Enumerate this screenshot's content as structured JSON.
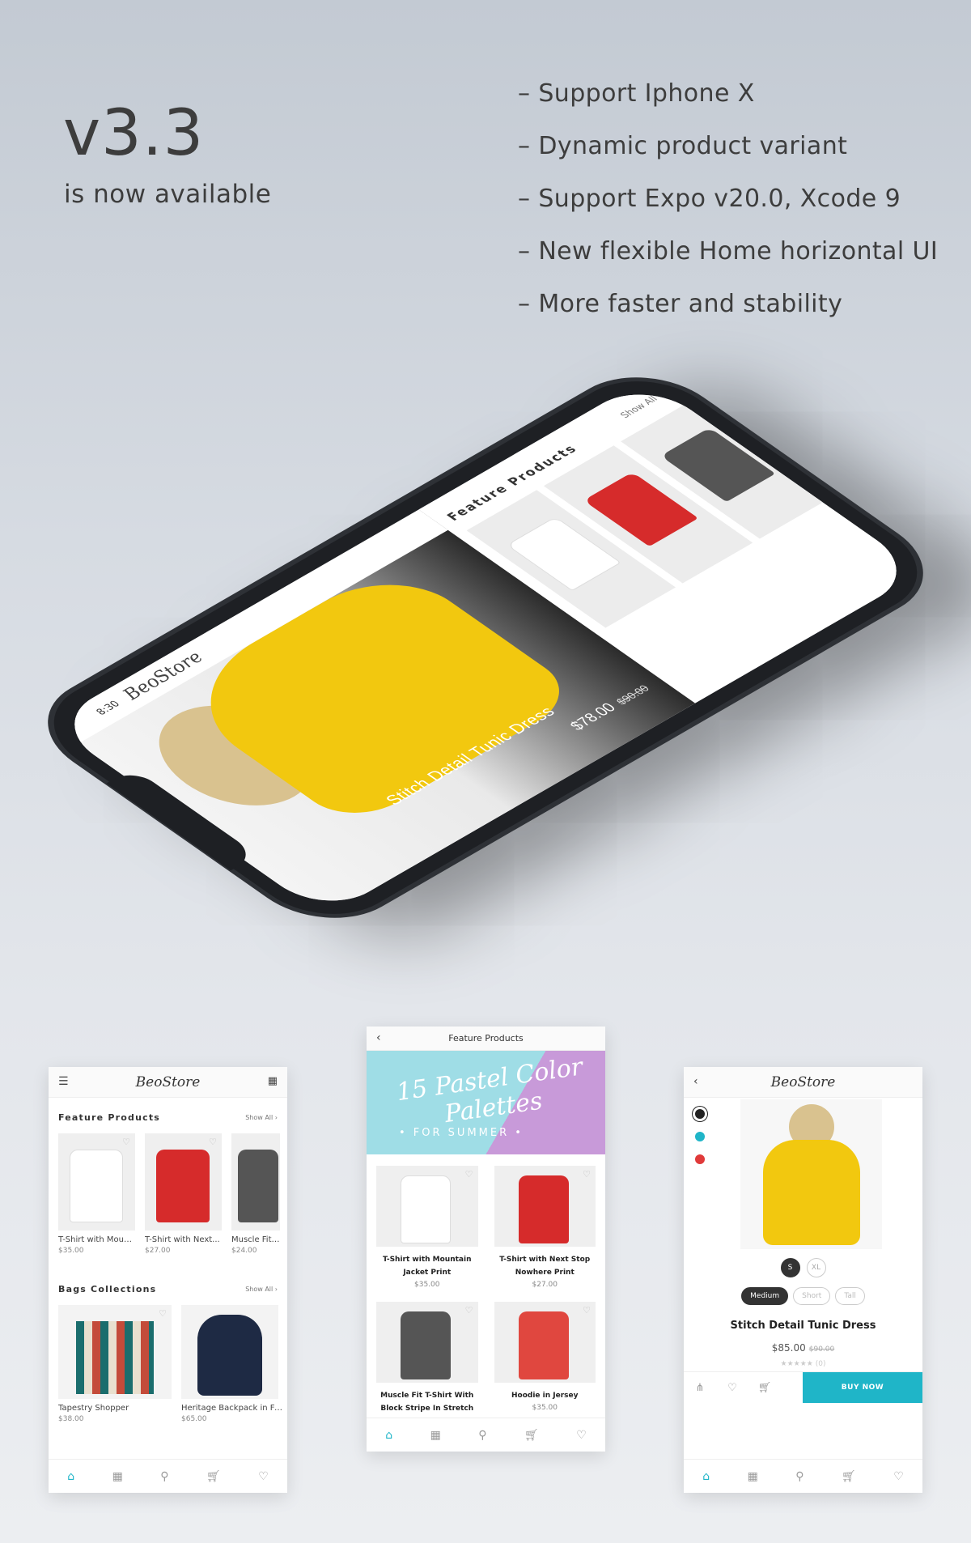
{
  "headline": {
    "version": "v3.3",
    "subtitle": "is now available"
  },
  "features": [
    "– Support Iphone X",
    "– Dynamic product variant",
    "– Support Expo v20.0, Xcode 9",
    "– New flexible Home horizontal UI",
    "– More faster and stability"
  ],
  "phone": {
    "status_time": "8:30",
    "brand": "BeoStore",
    "hero_title": "Stitch Detail Tunic Dress",
    "hero_price": "$78.00",
    "hero_old_price": "$90.00",
    "section_title": "Feature Products",
    "show_all": "Show All"
  },
  "left_screen": {
    "brand": "BeoStore",
    "section1": {
      "title": "Feature Products",
      "show_all": "Show All",
      "items": [
        {
          "name": "T-Shirt with Moun...",
          "price": "$35.00"
        },
        {
          "name": "T-Shirt with Next...",
          "price": "$27.00"
        },
        {
          "name": "Muscle Fit T-Sh",
          "price": "$24.00"
        }
      ]
    },
    "section2": {
      "title": "Bags Collections",
      "show_all": "Show All",
      "items": [
        {
          "name": "Tapestry Shopper",
          "price": "$38.00"
        },
        {
          "name": "Heritage Backpack in Feath",
          "price": "$65.00"
        }
      ]
    }
  },
  "middle_screen": {
    "title": "Feature Products",
    "banner_line1": "15 Pastel Color Palettes",
    "banner_line2": "• FOR SUMMER •",
    "items": [
      {
        "name": "T-Shirt with Mountain Jacket Print",
        "price": "$35.00"
      },
      {
        "name": "T-Shirt with Next Stop Nowhere Print",
        "price": "$27.00"
      },
      {
        "name": "Muscle Fit T-Shirt With Block Stripe In Stretch",
        "price": ""
      },
      {
        "name": "Hoodie in Jersey",
        "price": "$35.00"
      }
    ]
  },
  "right_screen": {
    "brand": "BeoStore",
    "colors": [
      "#222222",
      "#1fb5c8",
      "#e03a3a"
    ],
    "sizes": [
      {
        "label": "S",
        "selected": true
      },
      {
        "label": "XL",
        "selected": false
      }
    ],
    "lengths": [
      {
        "label": "Medium",
        "selected": true
      },
      {
        "label": "Short",
        "selected": false
      },
      {
        "label": "Tall",
        "selected": false
      }
    ],
    "product_name": "Stitch Detail Tunic Dress",
    "price": "$85.00",
    "old_price": "$90.00",
    "rating_count": "(0)",
    "buy_label": "BUY NOW"
  },
  "colors": {
    "accent": "#1fb5c8"
  }
}
